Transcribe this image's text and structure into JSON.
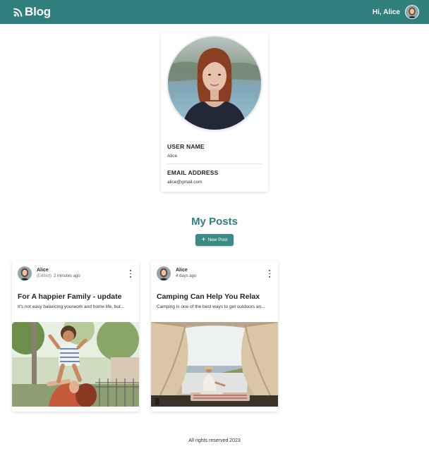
{
  "header": {
    "brand": "Blog",
    "brand_icon": "rss-feed-icon",
    "greeting": "Hi, Alice",
    "accent_color": "#2f7f7c"
  },
  "profile": {
    "username_label": "USER NAME",
    "username": "Alice",
    "email_label": "EMAIL ADDRESS",
    "email": "alice@gmail.com"
  },
  "posts_section": {
    "title": "My Posts",
    "new_post_label": "New Post",
    "new_post_icon": "plus-icon"
  },
  "posts": [
    {
      "author": "Alice",
      "edited": "(Edited)",
      "time": "2 minutes ago",
      "title": "For A happier Family - update",
      "excerpt": "It's not easy balancing yourwork and home life, but..."
    },
    {
      "author": "Alice",
      "edited": "",
      "time": "4 days ago",
      "title": "Camping Can Help You Relax",
      "excerpt": "Camping is one of the best ways to get outdoors an..."
    }
  ],
  "footer": {
    "text": "All rights reserved 2023"
  }
}
